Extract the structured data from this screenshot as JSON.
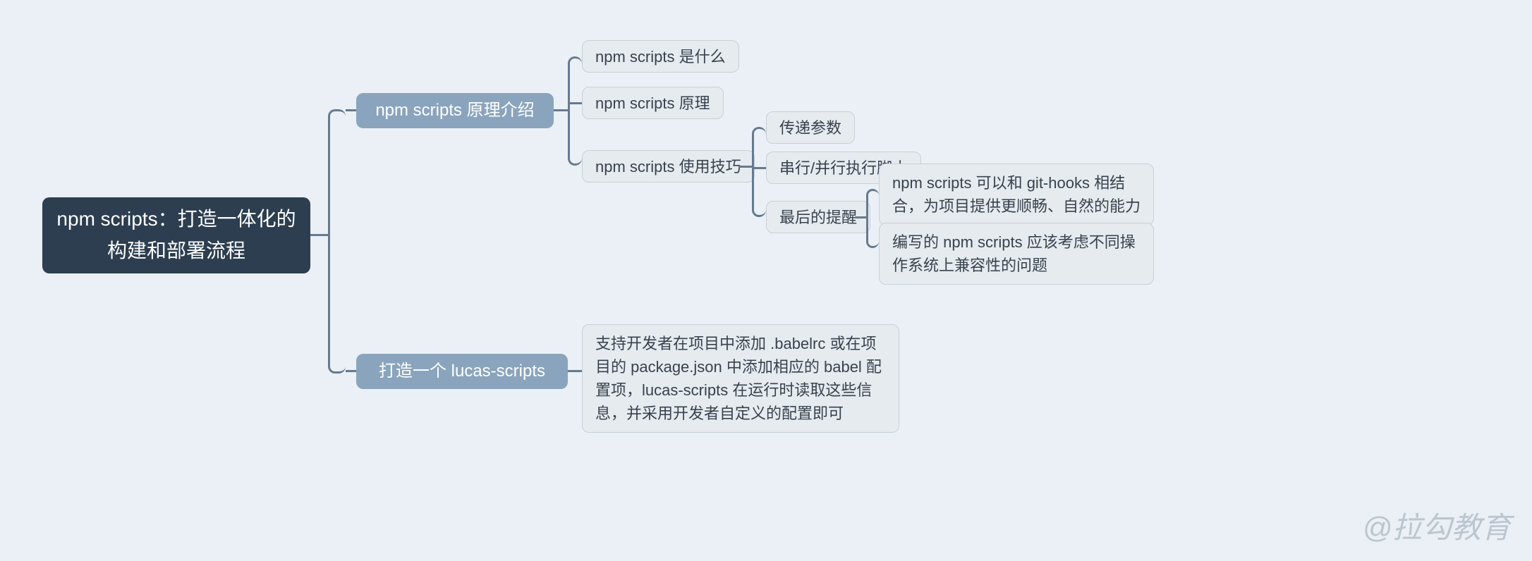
{
  "root": {
    "label": "npm scripts：打造一体化的构建和部署流程"
  },
  "branch1": {
    "label": "npm scripts 原理介绍",
    "children": {
      "c1": "npm scripts 是什么",
      "c2": "npm scripts 原理",
      "c3": {
        "label": "npm scripts 使用技巧",
        "children": {
          "g1": "传递参数",
          "g2": "串行/并行执行脚本",
          "g3": {
            "label": "最后的提醒",
            "children": {
              "t1": "npm scripts 可以和 git-hooks 相结合，为项目提供更顺畅、自然的能力",
              "t2": "编写的 npm scripts 应该考虑不同操作系统上兼容性的问题"
            }
          }
        }
      }
    }
  },
  "branch2": {
    "label": "打造一个 lucas-scripts",
    "desc": "支持开发者在项目中添加 .babelrc 或在项目的 package.json 中添加相应的 babel 配置项，lucas-scripts 在运行时读取这些信息，并采用开发者自定义的配置即可"
  },
  "watermark": "@拉勾教育"
}
